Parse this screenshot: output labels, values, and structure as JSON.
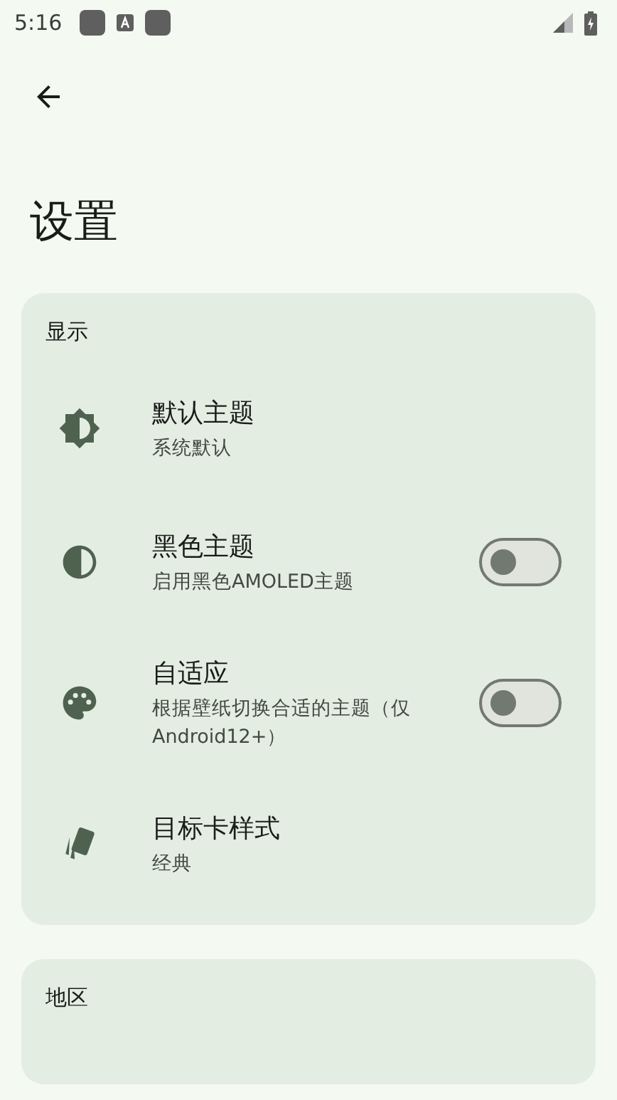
{
  "status_bar": {
    "time": "5:16"
  },
  "header": {
    "title": "设置"
  },
  "sections": [
    {
      "title": "显示",
      "items": [
        {
          "kind": "plain",
          "title": "默认主题",
          "subtitle": "系统默认"
        },
        {
          "kind": "switch",
          "title": "黑色主题",
          "subtitle": "启用黑色AMOLED主题",
          "on": false
        },
        {
          "kind": "switch",
          "title": "自适应",
          "subtitle": "根据壁纸切换合适的主题（仅Android12+）",
          "on": false
        },
        {
          "kind": "plain",
          "title": "目标卡样式",
          "subtitle": "经典"
        }
      ]
    },
    {
      "title": "地区"
    }
  ]
}
